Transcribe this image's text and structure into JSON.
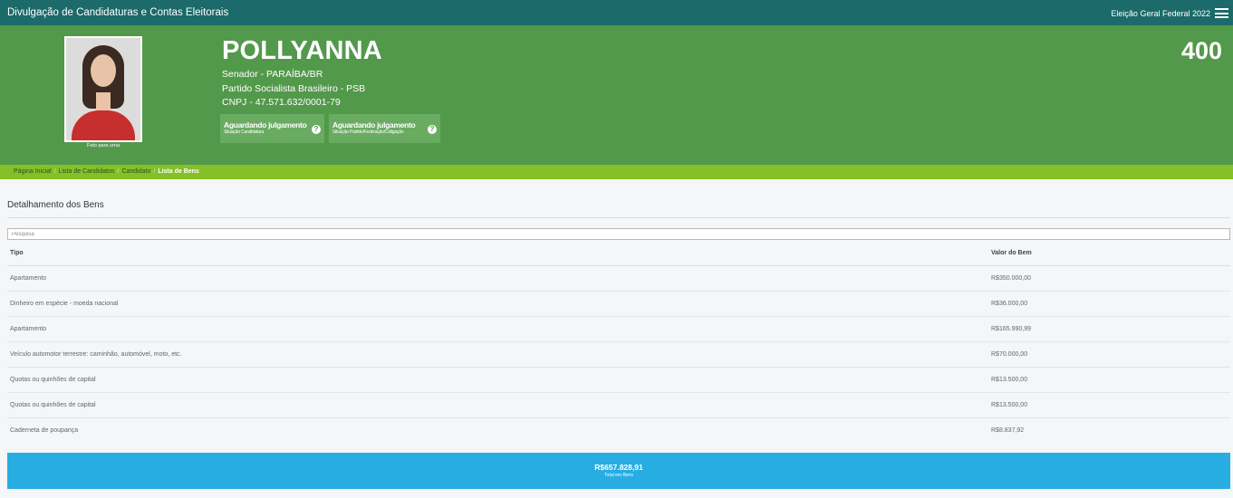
{
  "header": {
    "title": "Divulgação de Candidaturas e Contas Eleitorais",
    "election": "Eleição Geral Federal 2022",
    "menu_icon": "hamburger-menu-icon"
  },
  "candidate": {
    "photo_caption": "Foto para urna",
    "name": "POLLYANNA",
    "number": "400",
    "office": "Senador - PARAÍBA/BR",
    "party": "Partido Socialista Brasileiro - PSB",
    "cnpj": "CNPJ - 47.571.632/0001-79",
    "status_candidacy": {
      "main": "Aguardando julgamento",
      "sub": "Situação Candidatura"
    },
    "status_party": {
      "main": "Aguardando julgamento",
      "sub": "Situação Partido/Federação/Coligação"
    },
    "help_glyph": "?"
  },
  "breadcrumb": {
    "items": [
      "Página Inicial",
      "Lista de Candidatos",
      "Candidato"
    ],
    "current": "Lista de Bens",
    "separator": "/"
  },
  "assets": {
    "section_title": "Detalhamento dos Bens",
    "search_placeholder": "Pesquisa",
    "columns": [
      "Tipo",
      "Valor do Bem"
    ],
    "rows": [
      {
        "tipo": "Apartamento",
        "valor": "R$350.000,00"
      },
      {
        "tipo": "Dinheiro em espécie - moeda nacional",
        "valor": "R$36.000,00"
      },
      {
        "tipo": "Apartamento",
        "valor": "R$165.990,99"
      },
      {
        "tipo": "Veículo automotor terrestre: caminhão, automóvel, moto, etc.",
        "valor": "R$70.000,00"
      },
      {
        "tipo": "Quotas ou quinhões de capital",
        "valor": "R$13.500,00"
      },
      {
        "tipo": "Quotas ou quinhões de capital",
        "valor": "R$13.500,00"
      },
      {
        "tipo": "Caderneta de poupança",
        "valor": "R$8.837,92"
      }
    ],
    "total_value": "R$657.828,91",
    "total_label": "Total em Bens"
  },
  "colors": {
    "topbar": "#1c6a6a",
    "hero": "#53994b",
    "breadcrumb": "#86c028",
    "total": "#27ade2"
  }
}
